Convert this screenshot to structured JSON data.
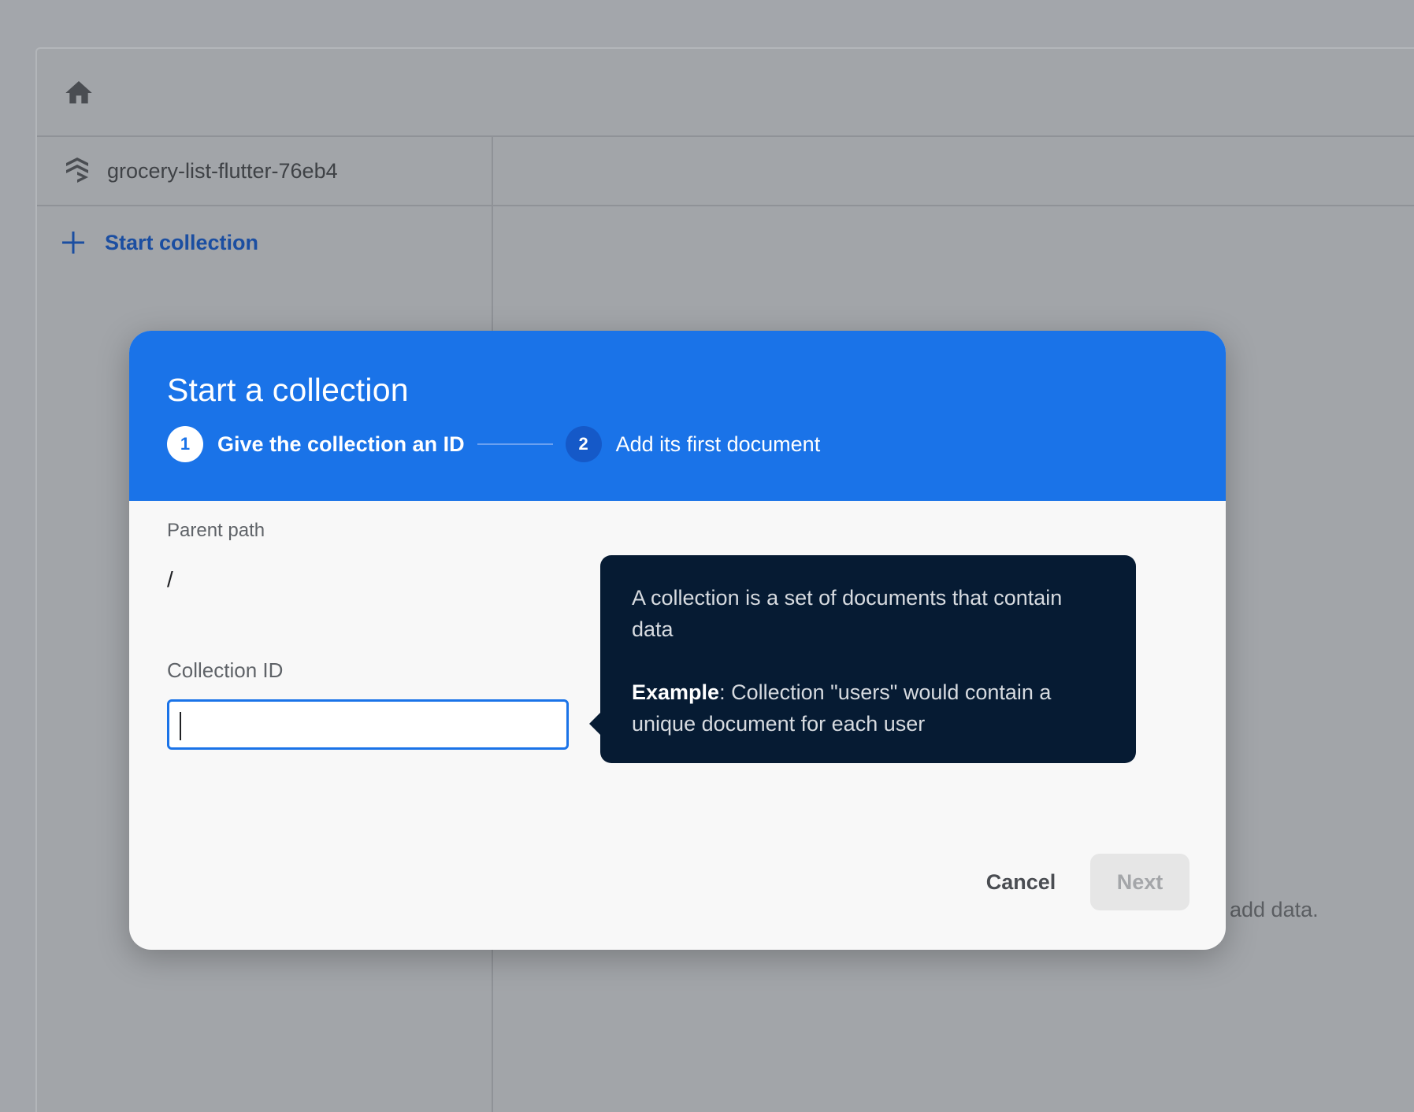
{
  "console": {
    "home_icon": "home-icon",
    "project_icon": "firestore-stack-icon",
    "project_name": "grocery-list-flutter-76eb4",
    "start_collection_label": "Start collection",
    "hint_fragment": "add data."
  },
  "dialog": {
    "title": "Start a collection",
    "steps": [
      {
        "number": "1",
        "label": "Give the collection an ID",
        "state": "active"
      },
      {
        "number": "2",
        "label": "Add its first document",
        "state": "inactive"
      }
    ],
    "parent_path_label": "Parent path",
    "parent_path_value": "/",
    "collection_id_label": "Collection ID",
    "collection_id_value": "",
    "tooltip": {
      "line1": "A collection is a set of documents that contain data",
      "example_label": "Example",
      "example_text": ": Collection \"users\" would contain a unique document for each user"
    },
    "cancel_label": "Cancel",
    "next_label": "Next"
  },
  "colors": {
    "header_blue": "#1a73e8",
    "tooltip_bg": "#061b33",
    "link_blue": "#1b4ea1",
    "backdrop": "#a3a6ab"
  }
}
